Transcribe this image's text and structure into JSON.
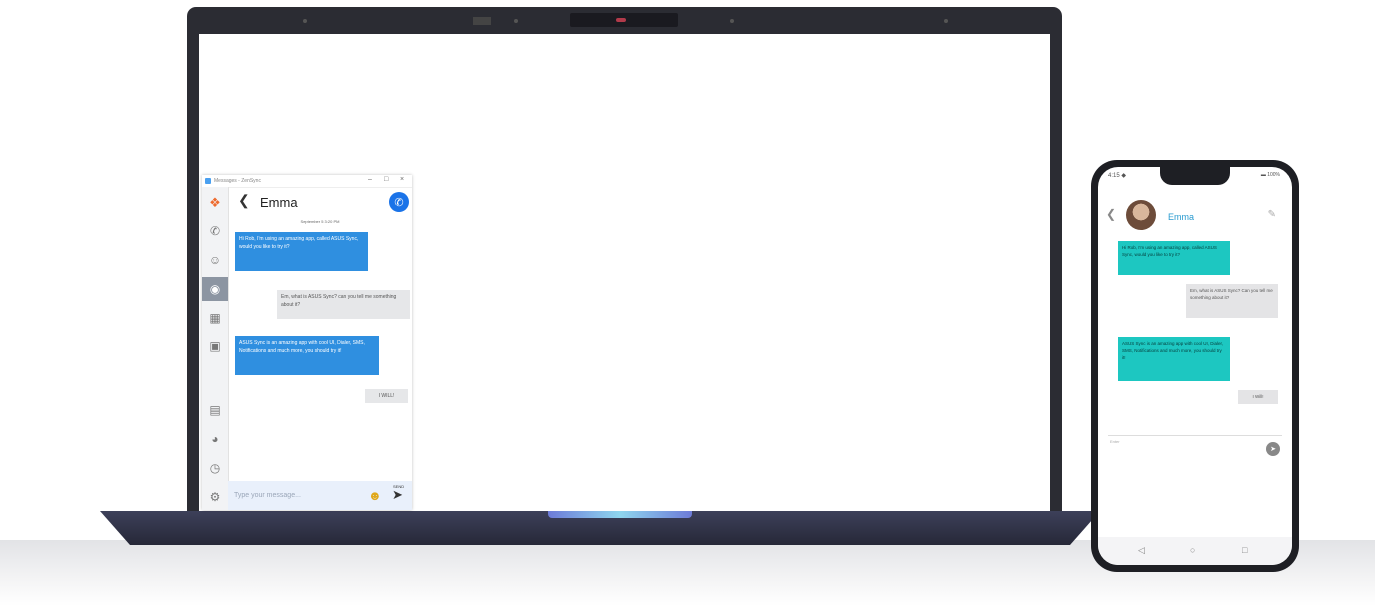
{
  "laptop_app": {
    "window_title": "Messages - ZenSync",
    "window_controls": {
      "minimize": "–",
      "maximize": "□",
      "close": "×"
    },
    "sidebar_icons": [
      "app-logo-icon",
      "phone-icon",
      "contacts-icon",
      "messages-icon",
      "apps-grid-icon",
      "screen-cast-icon",
      "feedback-icon",
      "help-icon",
      "info-icon",
      "settings-icon"
    ],
    "contact_name": "Emma",
    "date": "September 5  3:20 PM",
    "messages": [
      {
        "dir": "in",
        "text": "Hi Rob, I'm using an amazing app, called ASUS Sync, would you like to try it?"
      },
      {
        "dir": "out",
        "text": "Em, what is ASUS Sync? can you tell me something about it?"
      },
      {
        "dir": "in",
        "text": "ASUS Sync is an amazing app with cool UI, Dialer, SMS, Notifications and much more, you should try it!"
      },
      {
        "dir": "out",
        "text": "I WILL!"
      }
    ],
    "input_placeholder": "Type your message...",
    "send_label": "SEND"
  },
  "phone_app": {
    "status_left": "4:15  ◆",
    "status_right": "▬ 100%",
    "contact_name": "Emma",
    "messages": [
      {
        "dir": "in",
        "text": "Hi Rob, I'm using an amazing app, called ASUS Sync, would you like to try it?"
      },
      {
        "dir": "out",
        "text": "Em, what is ASUS Sync? Can you tell me something about it?"
      },
      {
        "dir": "in",
        "text": "ASUS Sync is an amazing app with cool UI, Dialer, SMS, Notifications and much more, you should try it!"
      },
      {
        "dir": "out",
        "text": "I Will!"
      }
    ],
    "input_placeholder": "Enter",
    "nav": {
      "back": "◁",
      "home": "○",
      "recents": "□"
    }
  },
  "colors": {
    "laptop_bubble_in": "#2f8fe0",
    "phone_bubble_in": "#1dc7c1",
    "call_button": "#1a73e8",
    "laptop_body": "#2b2c33"
  }
}
